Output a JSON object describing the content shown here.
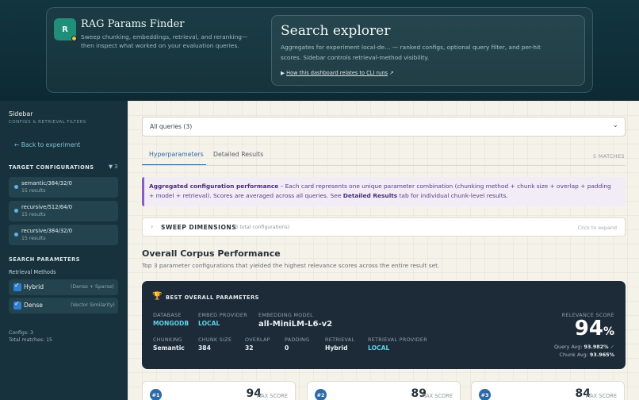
{
  "header": {
    "logo_letter": "R",
    "app_title": "RAG Params Finder",
    "app_description": "Sweep chunking, embeddings, retrieval, and reranking—then inspect what worked on your evaluation queries.",
    "explorer_title": "Search explorer",
    "explorer_description": "Aggregates for experiment local-de… — ranked configs, optional query filter, and per-hit scores. Sidebar controls retrieval-method visibility.",
    "explorer_link": "How this dashboard relates to CLI runs"
  },
  "sidebar": {
    "title": "Sidebar",
    "subtitle": "CONFIGS & RETRIEVAL FILTERS",
    "back_link": "← Back to experiment",
    "target_heading": "TARGET CONFIGURATIONS",
    "filter_count": "3",
    "configs": [
      {
        "name": "semantic/384/32/0",
        "results": "15 results"
      },
      {
        "name": "recursive/512/64/0",
        "results": "15 results"
      },
      {
        "name": "recursive/384/32/0",
        "results": "15 results"
      }
    ],
    "search_heading": "SEARCH PARAMETERS",
    "retrieval_label": "Retrieval Methods",
    "methods": [
      {
        "name": "Hybrid",
        "desc": "(Dense + Sparse)",
        "checked": true
      },
      {
        "name": "Dense",
        "desc": "(Vector Similarity)",
        "checked": true
      }
    ],
    "configs_stat": "Configs: 3",
    "matches_stat": "Total matches: 15"
  },
  "main": {
    "query_select": "All queries (3)",
    "tabs": [
      {
        "label": "Hyperparameters",
        "active": true
      },
      {
        "label": "Detailed Results",
        "active": false
      }
    ],
    "matches": "5 MATCHES",
    "info_title": "Aggregated configuration performance",
    "info_text_1": " – Each card represents one unique parameter combination (chunking method + chunk size + overlap + padding + model + retrieval). Scores are averaged across all queries. See ",
    "info_link": "Detailed Results",
    "info_text_2": " tab for individual chunk-level results.",
    "sweep_title": "SWEEP DIMENSIONS",
    "sweep_count": "(3 total configurations)",
    "sweep_hint": "Click to expand",
    "section_title": "Overall Corpus Performance",
    "section_subtitle": "Top 3 parameter configurations that yielded the highest relevance scores across the entire result set.",
    "best": {
      "title": "BEST OVERALL PARAMETERS",
      "database_k": "DATABASE",
      "database_v": "MONGODB",
      "embed_provider_k": "EMBED PROVIDER",
      "embed_provider_v": "LOCAL",
      "embed_model_k": "EMBEDDING MODEL",
      "embed_model_v": "all-MiniLM-L6-v2",
      "chunking_k": "CHUNKING",
      "chunking_v": "Semantic",
      "chunk_size_k": "CHUNK SIZE",
      "chunk_size_v": "384",
      "overlap_k": "OVERLAP",
      "overlap_v": "32",
      "padding_k": "PADDING",
      "padding_v": "0",
      "retrieval_k": "RETRIEVAL",
      "retrieval_v": "Hybrid",
      "retrieval_provider_k": "RETRIEVAL PROVIDER",
      "retrieval_provider_v": "LOCAL",
      "relevance_k": "RELEVANCE SCORE",
      "relevance_v": "94",
      "relevance_unit": "%",
      "query_avg_label": "Query Avg: ",
      "query_avg": "93.982%",
      "chunk_avg_label": "Chunk Avg: ",
      "chunk_avg": "93.965%"
    },
    "cards": [
      {
        "rank": "#1",
        "score": "94",
        "label": "MAX SCORE"
      },
      {
        "rank": "#2",
        "score": "89",
        "label": "MAX SCORE"
      },
      {
        "rank": "#3",
        "score": "84",
        "label": "MAX SCORE"
      }
    ]
  }
}
